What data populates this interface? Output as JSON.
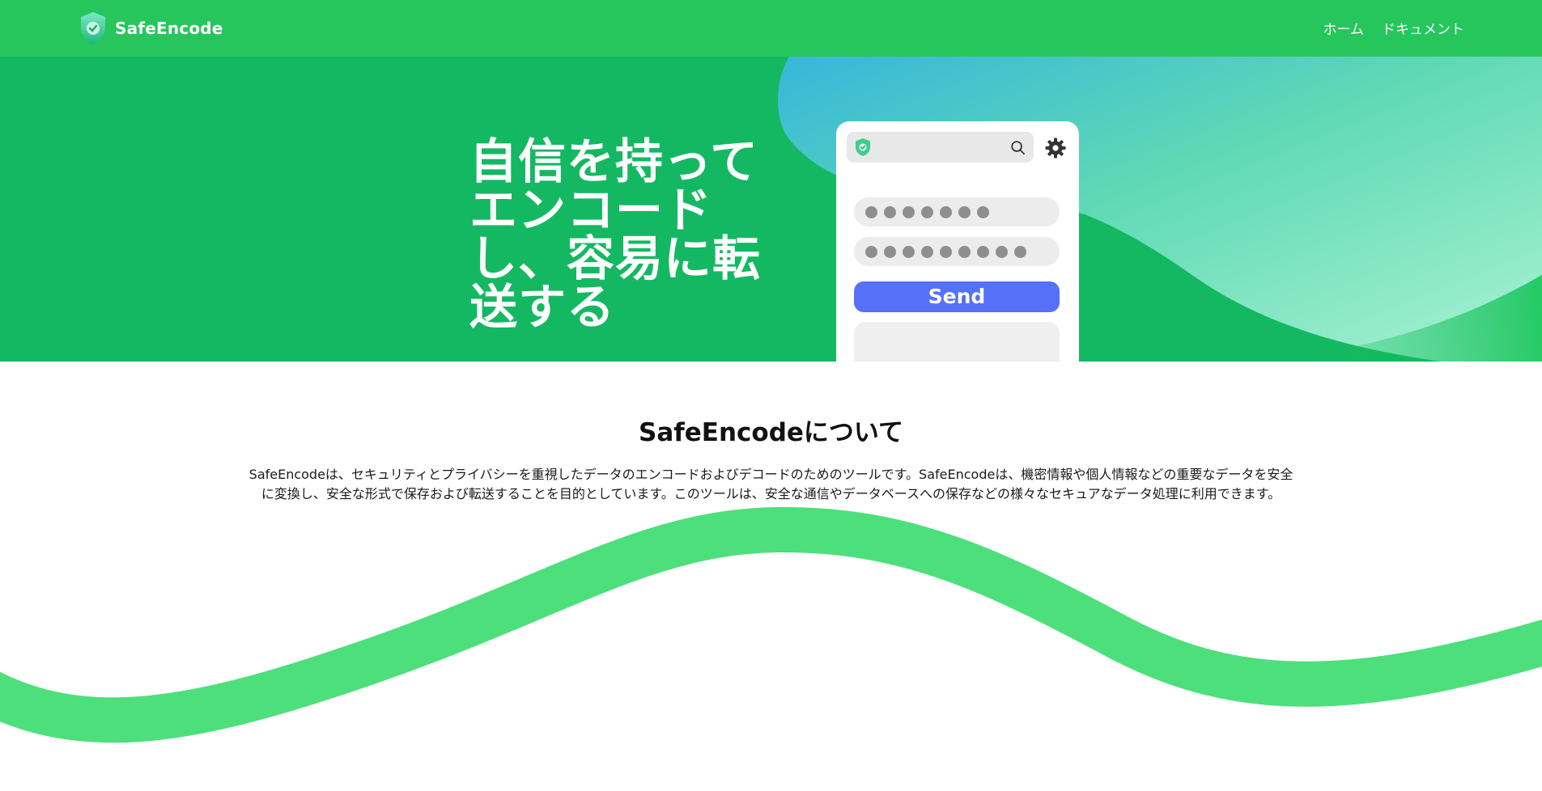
{
  "navbar": {
    "brand_name": "SafeEncode",
    "links": [
      {
        "label": "ホーム"
      },
      {
        "label": "ドキュメント"
      }
    ]
  },
  "hero": {
    "headline": "自信を持って\nエンコード\nし、容易に転\n送する",
    "mockup": {
      "password_field_1_dots": 7,
      "password_field_2_dots": 9,
      "send_label": "Send"
    }
  },
  "about": {
    "title": "SafeEncodeについて",
    "text": "SafeEncodeは、セキュリティとプライバシーを重視したデータのエンコードおよびデコードのためのツールです。SafeEncodeは、機密情報や個人情報などの重要なデータを安全に変換し、安全な形式で保存および転送することを目的としています。このツールは、安全な通信やデータベースへの保存などの様々なセキュアなデータ処理に利用できます。"
  },
  "colors": {
    "navbar": "#26c65c",
    "hero": "#15b862",
    "accent_button": "#5571f7",
    "wave": "#4ddf7b",
    "hero_gradient_top": "#3bbad6",
    "hero_gradient_mid": "#62dcab"
  },
  "icons": {
    "logo": "shield-check-icon",
    "search": "search-icon",
    "settings": "gear-icon"
  }
}
